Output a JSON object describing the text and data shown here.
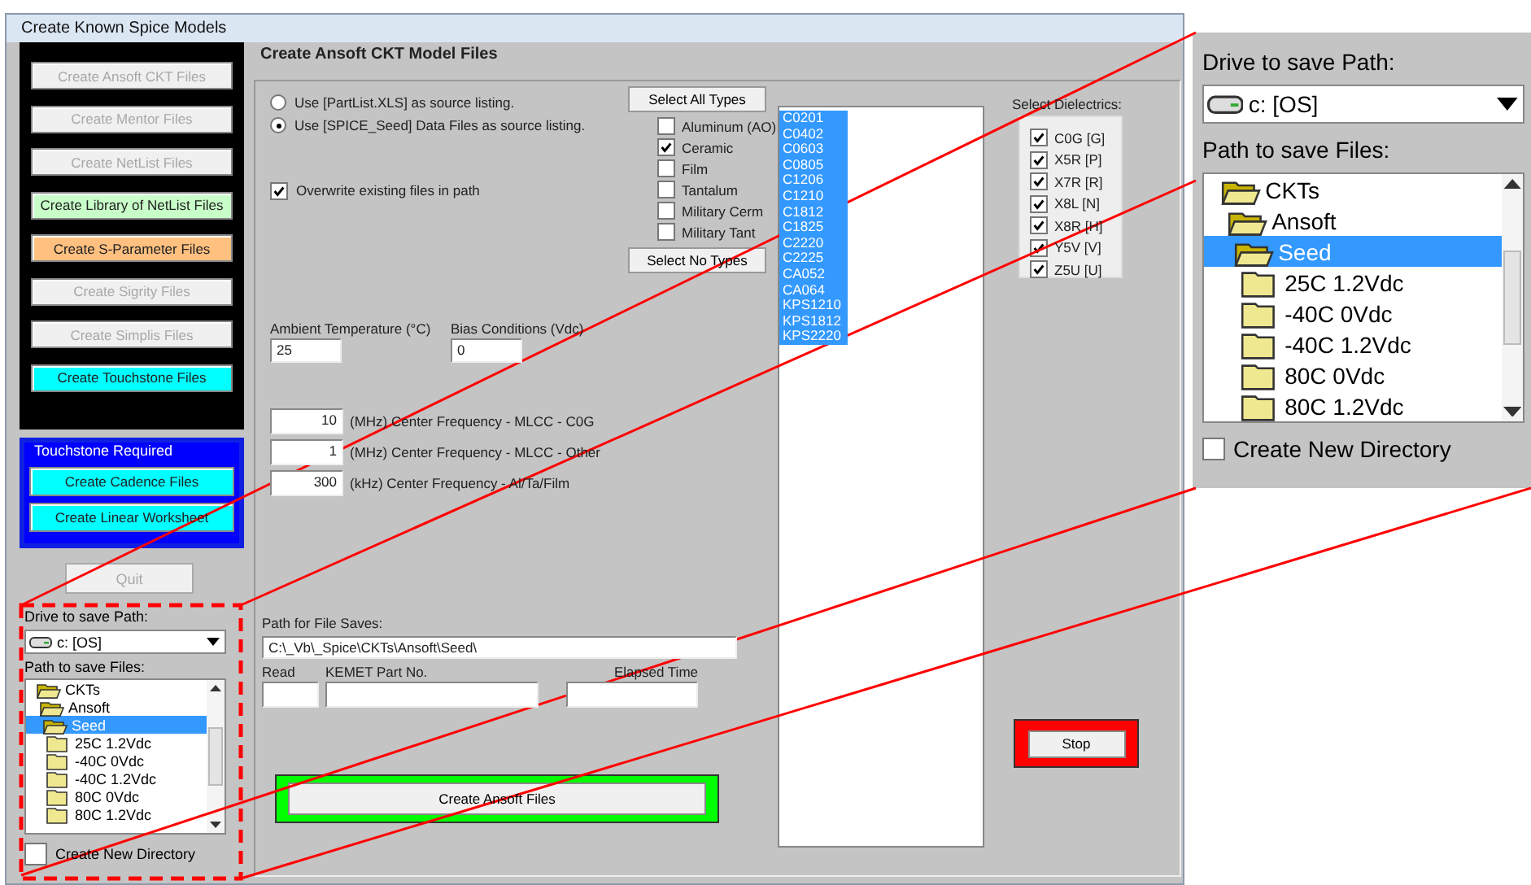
{
  "window": {
    "title": "Create Known Spice Models"
  },
  "model_buttons": [
    {
      "label": "Create Ansoft CKT Files",
      "disabled": true,
      "color": "#f0f0f0"
    },
    {
      "label": "Create Mentor Files",
      "disabled": true,
      "color": "#f0f0f0"
    },
    {
      "label": "Create NetList Files",
      "disabled": true,
      "color": "#f0f0f0"
    },
    {
      "label": "Create Library of NetList Files",
      "disabled": false,
      "color": "#c8ffc8"
    },
    {
      "label": "Create S-Parameter Files",
      "disabled": false,
      "color": "#ffc080"
    },
    {
      "label": "Create Sigrity Files",
      "disabled": true,
      "color": "#f0f0f0"
    },
    {
      "label": "Create Simplis Files",
      "disabled": true,
      "color": "#f0f0f0"
    },
    {
      "label": "Create Touchstone Files",
      "disabled": false,
      "color": "#00ffff"
    }
  ],
  "touchstone_group": {
    "title": "Touchstone Required",
    "buttons": [
      {
        "label": "Create Cadence Files",
        "disabled": false,
        "color": "#00ffff"
      },
      {
        "label": "Create Linear Worksheet",
        "disabled": false,
        "color": "#00ffff"
      }
    ]
  },
  "quit_button": {
    "label": "Quit",
    "disabled": true
  },
  "save_location": {
    "drive_label": "Drive to save Path:",
    "drive": "c: [OS]",
    "path_label": "Path to save Files:",
    "folders": [
      {
        "label": "CKTs",
        "expanded": true,
        "selected": false,
        "children": [
          {
            "label": "Ansoft",
            "expanded": true,
            "selected": false,
            "children": [
              {
                "label": "Seed",
                "expanded": true,
                "selected": true,
                "children": [
                  {
                    "label": "25C 1.2Vdc",
                    "expanded": false,
                    "selected": false
                  },
                  {
                    "label": "-40C 0Vdc",
                    "expanded": false,
                    "selected": false
                  },
                  {
                    "label": "-40C 1.2Vdc",
                    "expanded": false,
                    "selected": false
                  },
                  {
                    "label": "80C 0Vdc",
                    "expanded": false,
                    "selected": false
                  },
                  {
                    "label": "80C 1.2Vdc",
                    "expanded": false,
                    "selected": false
                  }
                ]
              }
            ]
          }
        ]
      }
    ],
    "new_directory": {
      "label": "Create New Directory",
      "checked": false
    }
  },
  "zoom_inset": {
    "drive_label": "Drive to save Path:",
    "drive": "c: [OS]",
    "path_label": "Path to save Files:",
    "folders": [
      {
        "label": "CKTs",
        "expanded": true,
        "selected": false,
        "children": [
          {
            "label": "Ansoft",
            "expanded": true,
            "selected": false,
            "children": [
              {
                "label": "Seed",
                "expanded": true,
                "selected": true,
                "children": [
                  {
                    "label": "25C 1.2Vdc",
                    "expanded": false,
                    "selected": false
                  },
                  {
                    "label": "-40C 0Vdc",
                    "expanded": false,
                    "selected": false
                  },
                  {
                    "label": "-40C 1.2Vdc",
                    "expanded": false,
                    "selected": false
                  },
                  {
                    "label": "80C 0Vdc",
                    "expanded": false,
                    "selected": false
                  },
                  {
                    "label": "80C 1.2Vdc",
                    "expanded": false,
                    "selected": false
                  }
                ]
              }
            ]
          }
        ]
      }
    ],
    "new_directory": {
      "label": "Create New Directory",
      "checked": false
    }
  },
  "panel": {
    "title": "Create Ansoft CKT Model Files",
    "source_options": [
      {
        "label": "Use [PartList.XLS] as source listing.",
        "selected": false
      },
      {
        "label": "Use [SPICE_Seed] Data Files as source listing.",
        "selected": true
      }
    ],
    "overwrite": {
      "label": "Overwrite existing files in path",
      "checked": true
    },
    "select_all_button": "Select All Types",
    "types": [
      {
        "label": "Aluminum (AO)",
        "checked": false
      },
      {
        "label": "Ceramic",
        "checked": true
      },
      {
        "label": "Film",
        "checked": false
      },
      {
        "label": "Tantalum",
        "checked": false
      },
      {
        "label": "Military Cerm",
        "checked": false
      },
      {
        "label": "Military Tant",
        "checked": false
      }
    ],
    "select_none_button": "Select No Types",
    "part_list": [
      {
        "label": "C0201",
        "selected": true
      },
      {
        "label": "C0402",
        "selected": true
      },
      {
        "label": "C0603",
        "selected": true
      },
      {
        "label": "C0805",
        "selected": true
      },
      {
        "label": "C1206",
        "selected": true
      },
      {
        "label": "C1210",
        "selected": true
      },
      {
        "label": "C1812",
        "selected": true
      },
      {
        "label": "C1825",
        "selected": true
      },
      {
        "label": "C2220",
        "selected": true
      },
      {
        "label": "C2225",
        "selected": true
      },
      {
        "label": "CA052",
        "selected": true
      },
      {
        "label": "CA064",
        "selected": true
      },
      {
        "label": "KPS1210",
        "selected": true
      },
      {
        "label": "KPS1812",
        "selected": true
      },
      {
        "label": "KPS2220",
        "selected": true
      }
    ],
    "dielectrics": {
      "label": "Select Dielectrics:",
      "items": [
        {
          "label": "C0G [G]",
          "checked": true
        },
        {
          "label": "X5R [P]",
          "checked": true
        },
        {
          "label": "X7R [R]",
          "checked": true
        },
        {
          "label": "X8L [N]",
          "checked": true
        },
        {
          "label": "X8R [H]",
          "checked": true
        },
        {
          "label": "Y5V [V]",
          "checked": true
        },
        {
          "label": "Z5U [U]",
          "checked": true
        }
      ]
    },
    "ambient_temperature": {
      "label": "Ambient Temperature (°C)",
      "value": "25"
    },
    "bias": {
      "label": "Bias Conditions (Vdc)",
      "value": "0"
    },
    "frequencies": [
      {
        "value": "10",
        "label": "(MHz) Center Frequency - MLCC - C0G"
      },
      {
        "value": "1",
        "label": "(MHz) Center Frequency - MLCC - Other"
      },
      {
        "value": "300",
        "label": "(kHz) Center Frequency - Al/Ta/Film"
      }
    ],
    "path": {
      "label": "Path for File Saves:",
      "value": "C:\\_Vb\\_Spice\\CKTs\\Ansoft\\Seed\\"
    },
    "read_label": "Read",
    "part_no_label": "KEMET Part No.",
    "elapsed_label": "Elapsed Time",
    "create_button": "Create Ansoft Files",
    "stop_button": "Stop"
  }
}
